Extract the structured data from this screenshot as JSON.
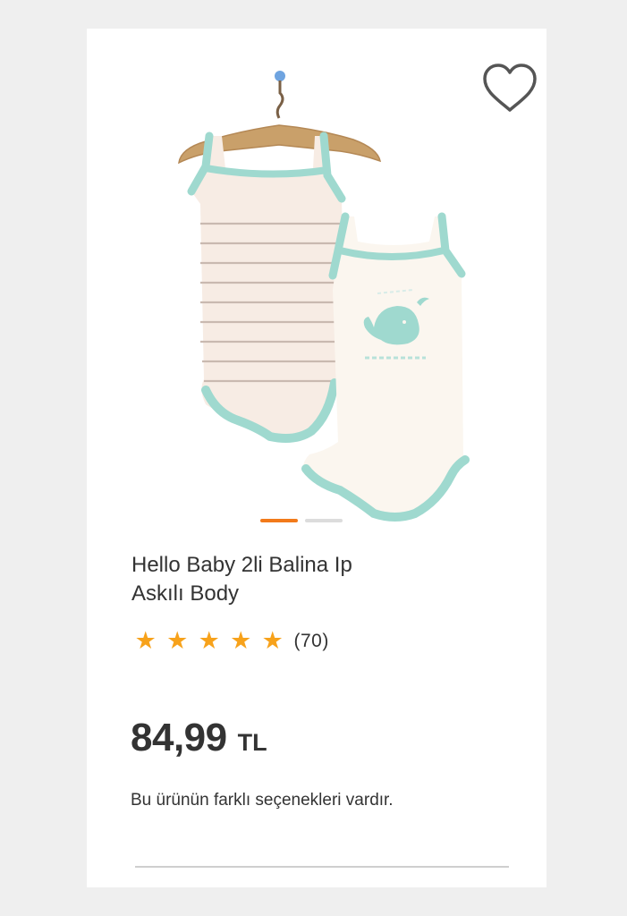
{
  "product": {
    "title_line1": "Hello Baby 2li Balina Ip",
    "title_line2": "Askılı Body",
    "rating_stars": 5,
    "review_count": "(70)",
    "price_value": "84,99",
    "price_currency": "TL",
    "variants_note": "Bu ürünün farklı seçenekleri vardır."
  },
  "carousel": {
    "active_index": 0,
    "slide_count": 2
  },
  "icons": {
    "favorite": "heart-outline-icon",
    "rating": "star-icon"
  },
  "colors": {
    "accent": "#f27a1a",
    "star": "#f7a21b",
    "text": "#333333",
    "trim": "#9fd9cf"
  }
}
